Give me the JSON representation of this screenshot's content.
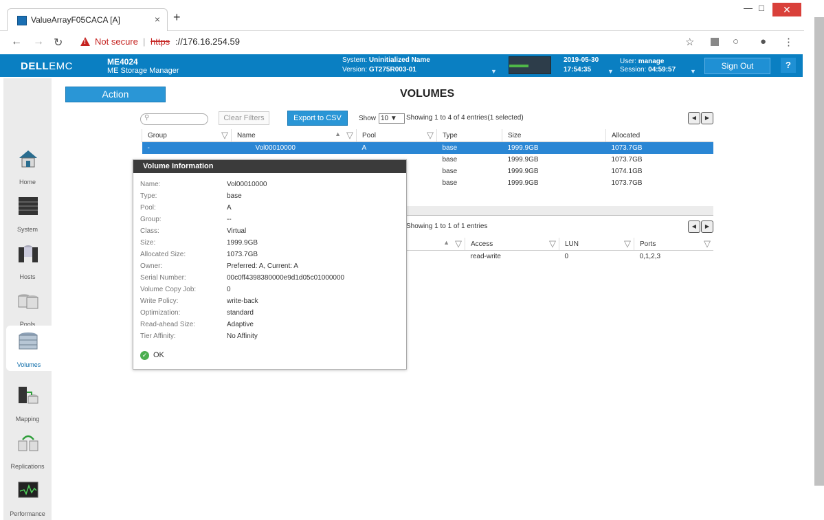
{
  "browser": {
    "tab_title": "ValueArrayF05CACA [A]",
    "tab_close": "×",
    "new_tab": "+",
    "security_label": "Not secure",
    "url_scheme": "https",
    "url_rest": "://176.16.254.59"
  },
  "header": {
    "brand": "DELL",
    "brand_suffix": "EMC",
    "model": "ME4024",
    "product": "ME Storage Manager",
    "system_label": "System:",
    "system_value": "Uninitialized Name",
    "version_label": "Version:",
    "version_value": "GT275R003-01",
    "date": "2019-05-30",
    "time": "17:54:35",
    "user_label": "User:",
    "user_value": "manage",
    "session_label": "Session:",
    "session_value": "04:59:57",
    "sign_out": "Sign Out",
    "help": "?"
  },
  "sidebar": {
    "items": [
      {
        "label": "Home",
        "icon": "home-icon"
      },
      {
        "label": "System",
        "icon": "system-icon"
      },
      {
        "label": "Hosts",
        "icon": "hosts-icon"
      },
      {
        "label": "Pools",
        "icon": "pools-icon"
      },
      {
        "label": "Volumes",
        "icon": "volumes-icon",
        "active": true
      },
      {
        "label": "Mapping",
        "icon": "mapping-icon"
      },
      {
        "label": "Replications",
        "icon": "replications-icon"
      },
      {
        "label": "Performance",
        "icon": "performance-icon"
      }
    ]
  },
  "main": {
    "action": "Action",
    "title": "VOLUMES",
    "clear_filters": "Clear Filters",
    "export_csv": "Export to CSV",
    "show_label": "Show",
    "show_value": "10",
    "showing": "Showing 1 to 4 of 4 entries(1 selected)",
    "volumes_table": {
      "columns": [
        "Group",
        "Name",
        "Pool",
        "Type",
        "Size",
        "Allocated"
      ],
      "rows": [
        {
          "group": "-",
          "name": "Vol00010000",
          "pool": "A",
          "type": "base",
          "size": "1999.9GB",
          "allocated": "1073.7GB",
          "selected": true
        },
        {
          "group": "",
          "name": "",
          "pool": "",
          "type": "base",
          "size": "1999.9GB",
          "allocated": "1073.7GB"
        },
        {
          "group": "",
          "name": "",
          "pool": "",
          "type": "base",
          "size": "1999.9GB",
          "allocated": "1074.1GB"
        },
        {
          "group": "",
          "name": "",
          "pool": "",
          "type": "base",
          "size": "1999.9GB",
          "allocated": "1073.7GB"
        }
      ]
    },
    "showing2": "Showing 1 to 1 of 1 entries",
    "mapping_table": {
      "columns": [
        "Access",
        "LUN",
        "Ports"
      ],
      "rows": [
        {
          "access": "read-write",
          "lun": "0",
          "ports": "0,1,2,3"
        }
      ]
    }
  },
  "popup": {
    "title": "Volume Information",
    "fields": [
      {
        "label": "Name:",
        "value": "Vol00010000"
      },
      {
        "label": "Type:",
        "value": "base"
      },
      {
        "label": "Pool:",
        "value": "A"
      },
      {
        "label": "Group:",
        "value": "--"
      },
      {
        "label": "Class:",
        "value": "Virtual"
      },
      {
        "label": "Size:",
        "value": "1999.9GB"
      },
      {
        "label": "Allocated Size:",
        "value": "1073.7GB"
      },
      {
        "label": "Owner:",
        "value": "Preferred: A, Current: A"
      },
      {
        "label": "Serial Number:",
        "value": "00c0ff4398380000e9d1d05c01000000"
      },
      {
        "label": "Volume Copy Job:",
        "value": "0"
      },
      {
        "label": "Write Policy:",
        "value": "write-back"
      },
      {
        "label": "Optimization:",
        "value": "standard"
      },
      {
        "label": "Read-ahead Size:",
        "value": "Adaptive"
      },
      {
        "label": "Tier Affinity:",
        "value": "No Affinity"
      }
    ],
    "ok": "OK"
  },
  "colors": {
    "brand_blue": "#0a7fc2",
    "selection": "#2a86d4",
    "popup_header": "#3b3b3b",
    "warning": "#c5221f"
  }
}
